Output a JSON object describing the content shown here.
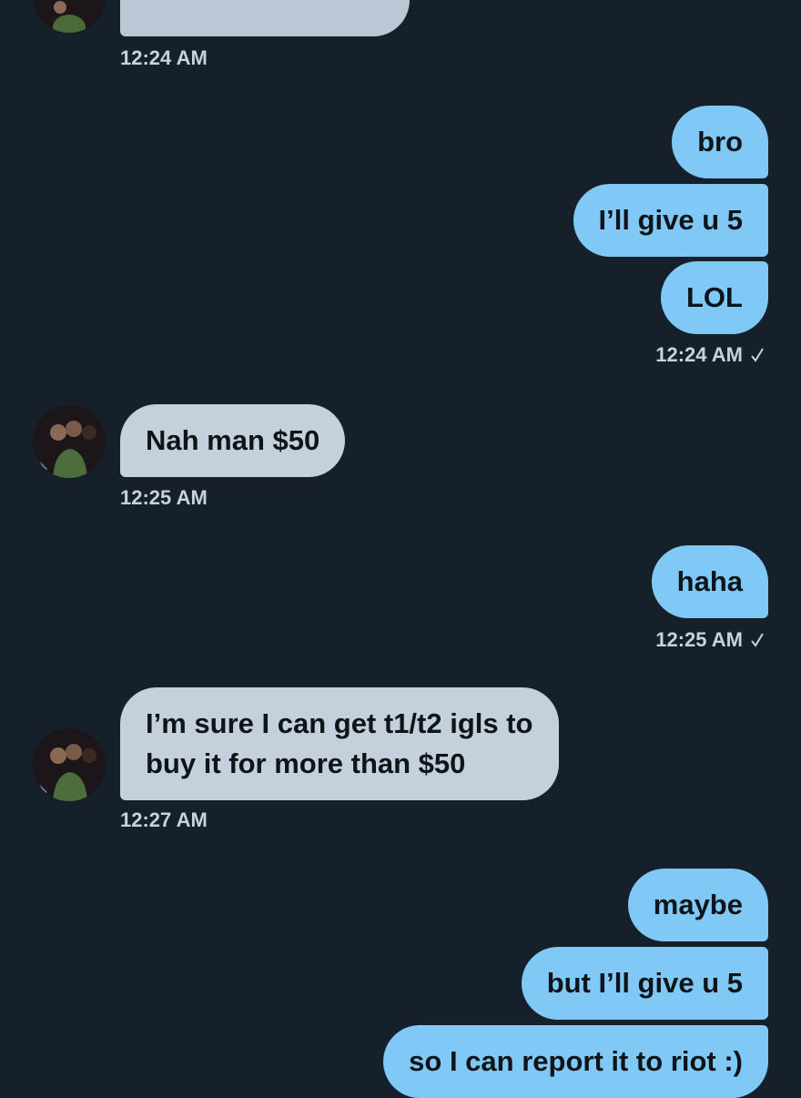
{
  "conversation": {
    "top": {
      "timestamp": "12:24 AM"
    },
    "group1": {
      "messages": [
        "bro",
        "I’ll give u 5",
        "LOL"
      ],
      "timestamp": "12:24 AM"
    },
    "reply1": {
      "text": "Nah man $50",
      "timestamp": "12:25 AM"
    },
    "group2": {
      "messages": [
        "haha"
      ],
      "timestamp": "12:25 AM"
    },
    "reply2": {
      "line1": "I’m sure I can get t1/t2 igls to",
      "line2": "buy it for more than $50",
      "timestamp": "12:27 AM"
    },
    "group3": {
      "messages": [
        "maybe",
        "but I’ll give u 5",
        "so I can report it to riot :)"
      ]
    }
  },
  "icons": {
    "read_receipt": "checkmark-icon",
    "avatar": "contact-avatar"
  },
  "colors": {
    "background": "#15202b",
    "incoming_bubble": "#c4d1dd",
    "outgoing_bubble": "#80c8f5",
    "text": "#0f1419",
    "timestamp": "#c8d2dc"
  }
}
